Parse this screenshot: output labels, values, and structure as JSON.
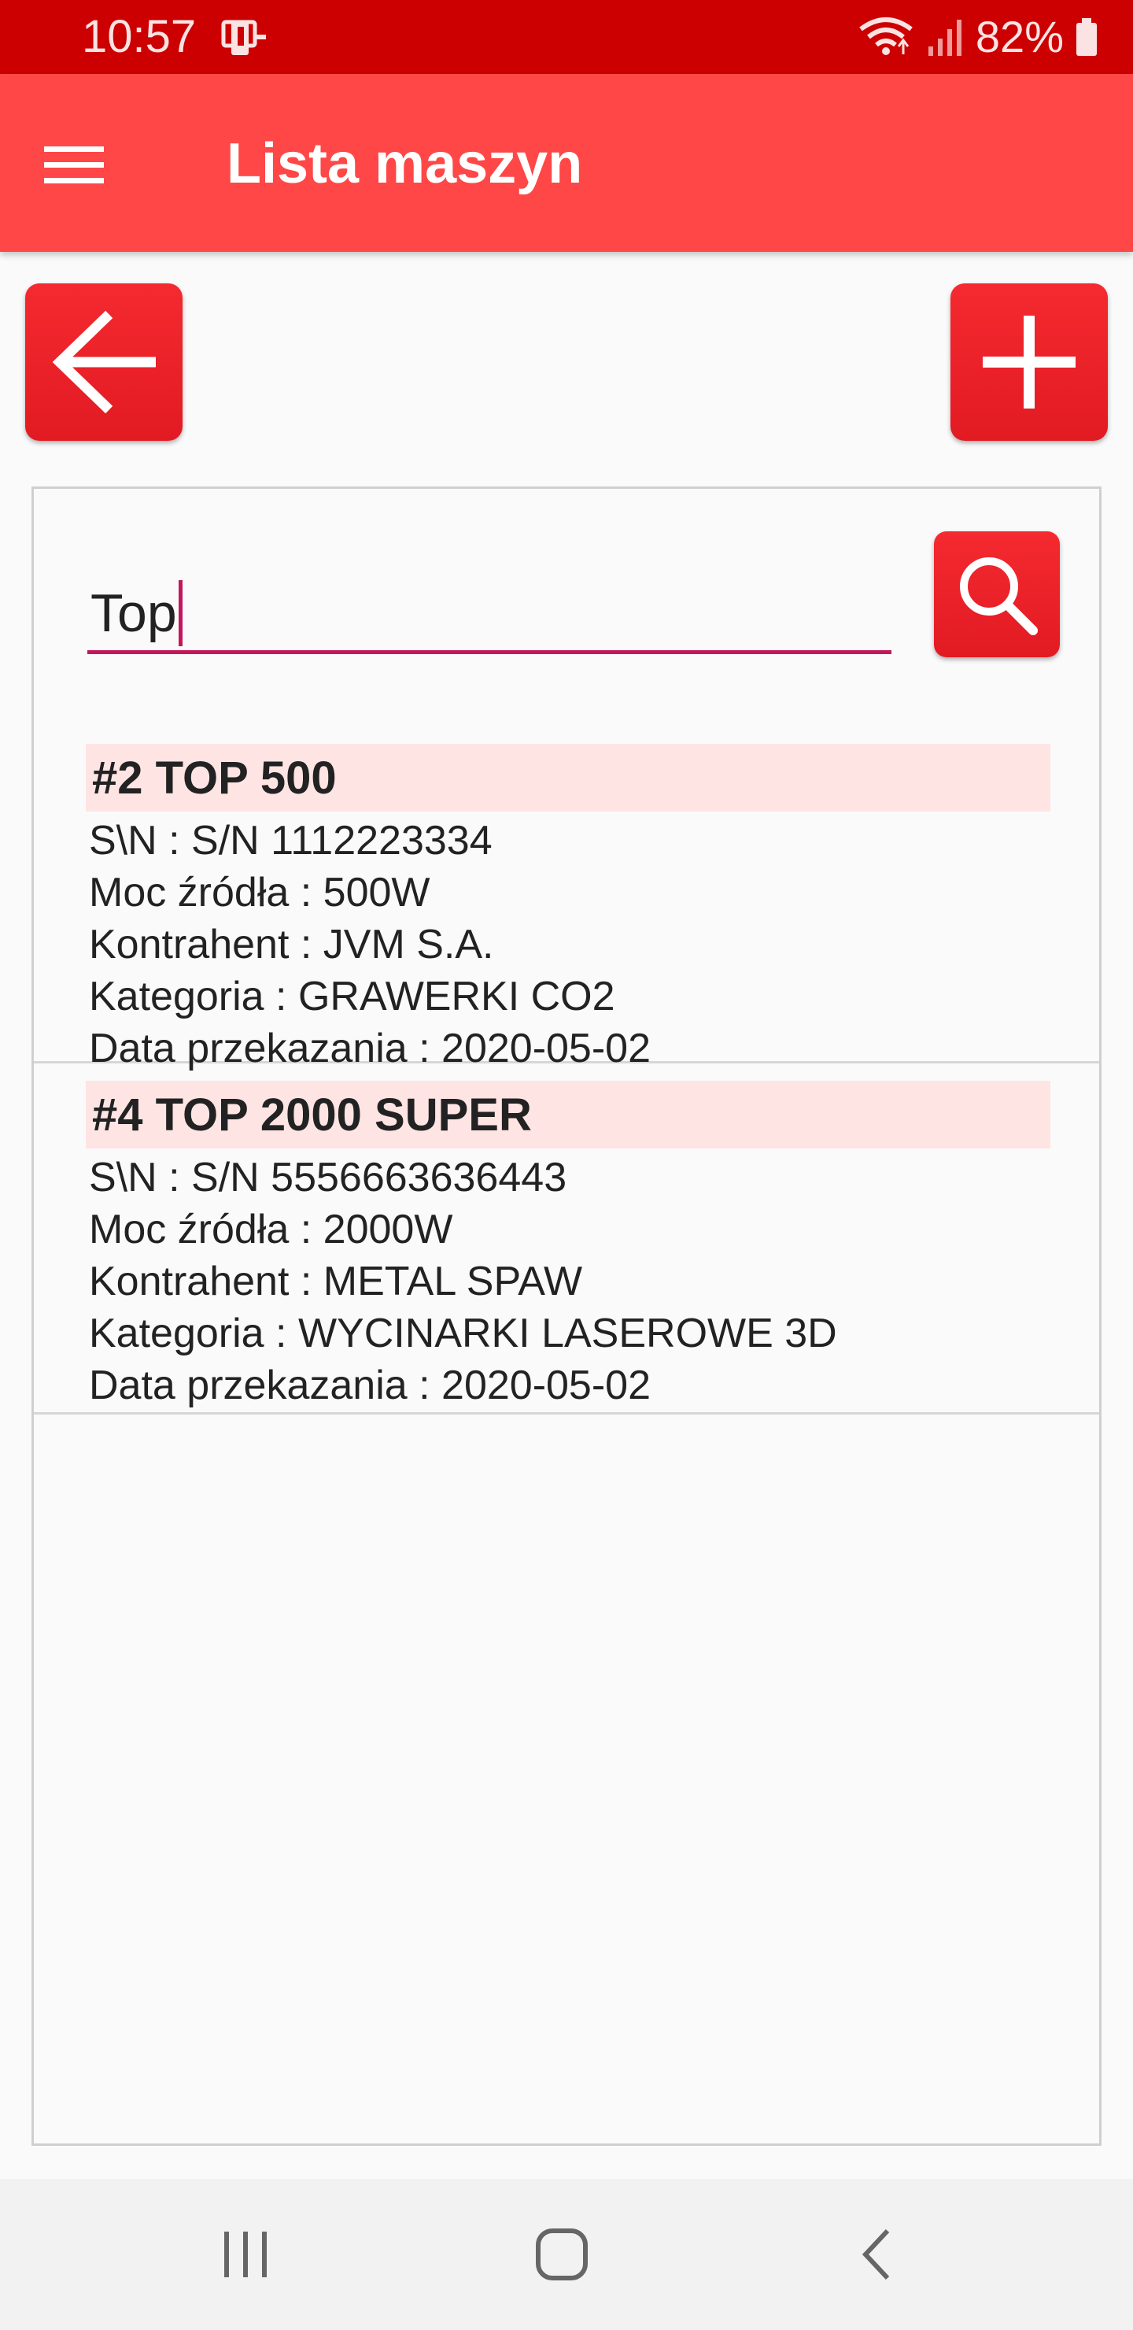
{
  "status_bar": {
    "time": "10:57",
    "battery": "82%",
    "icons": [
      "app-notification-icon",
      "wifi-icon",
      "signal-icon",
      "battery-icon"
    ]
  },
  "app_bar": {
    "title": "Lista maszyn",
    "background": "#ff4747",
    "menu_icon": "hamburger-menu-icon"
  },
  "actions": {
    "back_icon": "arrow-left-icon",
    "add_icon": "plus-icon",
    "button_color": "#e8202a"
  },
  "search": {
    "value": "Top",
    "icon": "search-icon"
  },
  "machines": [
    {
      "title": "#2 TOP 500",
      "details": [
        "S\\N : S/N 1112223334",
        "Moc źródła : 500W",
        "Kontrahent : JVM S.A.",
        "Kategoria : GRAWERKI CO2",
        "Data przekazania : 2020-05-02"
      ]
    },
    {
      "title": "#4 TOP 2000 SUPER",
      "details": [
        "S\\N : S/N 5556663636443",
        "Moc źródła : 2000W",
        "Kontrahent : METAL SPAW",
        "Kategoria : WYCINARKI LASEROWE 3D",
        "Data przekazania : 2020-05-02"
      ]
    }
  ],
  "nav_bar": {
    "icons": [
      "recent-apps-icon",
      "home-icon",
      "back-icon"
    ]
  }
}
